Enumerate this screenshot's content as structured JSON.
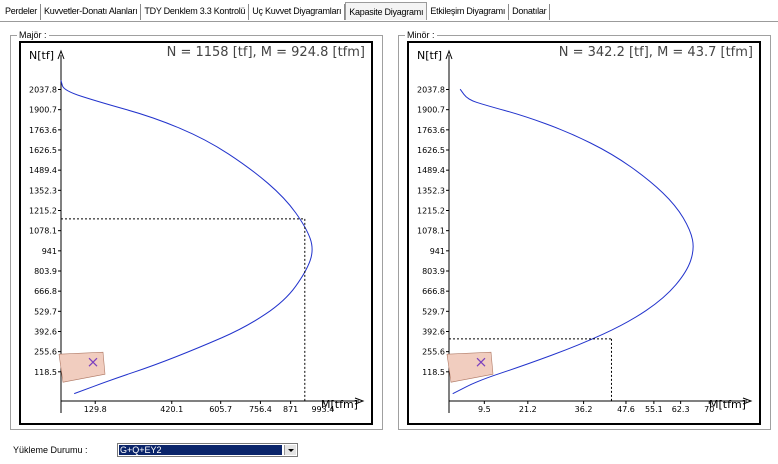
{
  "tabs": [
    {
      "label": "Perdeler",
      "active": false
    },
    {
      "label": "Kuvvetler-Donatı Alanları",
      "active": false
    },
    {
      "label": "TDY Denklem 3.3 Kontrolü",
      "active": false
    },
    {
      "label": "Uç Kuvvet Diyagramları",
      "active": false
    },
    {
      "label": "Kapasite Diyagramı",
      "active": true
    },
    {
      "label": "Etkileşim Diyagramı",
      "active": false
    },
    {
      "label": "Donatılar",
      "active": false
    }
  ],
  "major": {
    "caption": "Majör :",
    "header": "N = 1158 [tf], M = 924.8 [tfm]"
  },
  "minor": {
    "caption": "Minör :",
    "header": "N = 342.2 [tf], M = 43.7 [tfm]"
  },
  "load_case": {
    "label": "Yükleme Durumu :",
    "value": "G+Q+EY2"
  },
  "chart_data": [
    {
      "type": "line",
      "title": "N = 1158 [tf], M = 924.8 [tfm]",
      "xlabel": "M[tfm]",
      "ylabel": "N[tf]",
      "xticks": [
        "129.8",
        "420.1",
        "605.7",
        "756.4",
        "871",
        "993.4"
      ],
      "yticks": [
        "2037.8",
        "1900.7",
        "1763.6",
        "1626.5",
        "1489.4",
        "1352.3",
        "1215.2",
        "1078.1",
        "941",
        "803.9",
        "666.8",
        "529.7",
        "392.6",
        "255.6",
        "118.5"
      ],
      "series": [
        {
          "x": [
            0,
            10,
            150,
            350,
            550,
            720,
            850,
            930,
            960,
            930,
            850,
            700,
            520,
            350,
            200,
            50
          ],
          "y": [
            2100,
            2030,
            1950,
            1850,
            1700,
            1500,
            1300,
            1100,
            950,
            800,
            600,
            420,
            280,
            160,
            70,
            -30
          ]
        }
      ],
      "marker": {
        "M": 924.8,
        "N": 1158
      },
      "xlim": [
        0,
        1100
      ],
      "ylim": [
        -80,
        2150
      ],
      "grid": false
    },
    {
      "type": "line",
      "title": "N = 342.2 [tf], M = 43.7 [tfm]",
      "xlabel": "M[tfm]",
      "ylabel": "N[tf]",
      "xticks": [
        "9.5",
        "21.2",
        "36.2",
        "47.6",
        "55.1",
        "62.3",
        "70"
      ],
      "yticks": [
        "2037.8",
        "1900.7",
        "1763.6",
        "1626.5",
        "1489.4",
        "1352.3",
        "1215.2",
        "1078.1",
        "941",
        "803.9",
        "666.8",
        "529.7",
        "392.6",
        "255.6",
        "118.5"
      ],
      "series": [
        {
          "x": [
            3,
            5,
            10,
            20,
            32,
            44,
            54,
            61,
            65,
            66,
            64,
            58,
            48,
            35,
            20,
            8,
            1
          ],
          "y": [
            2040,
            1970,
            1930,
            1860,
            1750,
            1600,
            1420,
            1250,
            1080,
            950,
            800,
            620,
            450,
            300,
            160,
            60,
            -30
          ]
        }
      ],
      "marker": {
        "M": 43.7,
        "N": 342.2
      },
      "xlim": [
        0,
        78
      ],
      "ylim": [
        -80,
        2150
      ],
      "grid": false
    }
  ]
}
